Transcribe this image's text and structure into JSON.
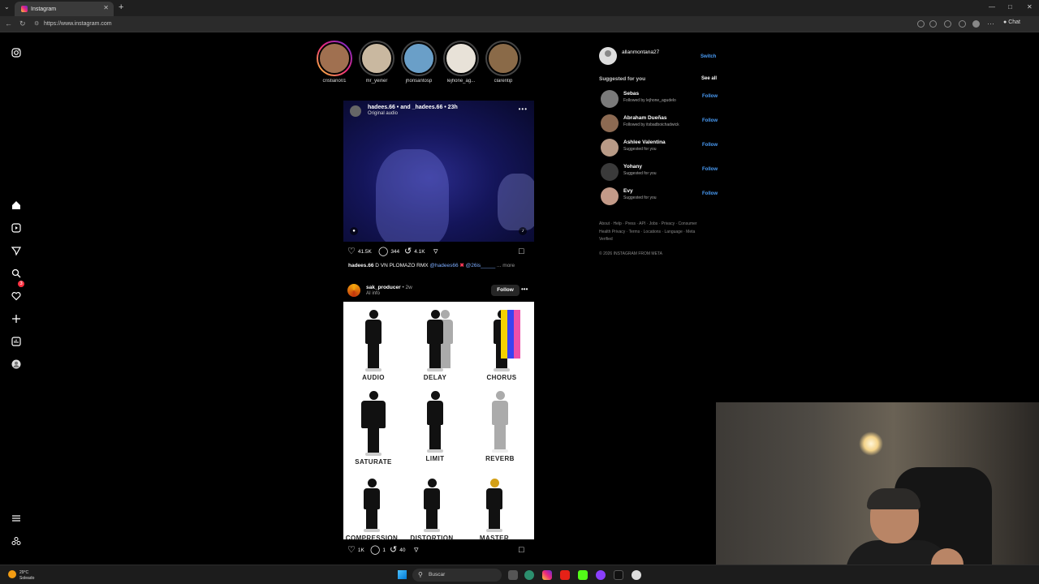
{
  "browser": {
    "tab_title": "Instagram",
    "url": "https://www.instagram.com",
    "chat_label": "Chat"
  },
  "stories": [
    {
      "username": "cristiano01",
      "seen": false,
      "color": "#a07050"
    },
    {
      "username": "mr_yeiner",
      "seen": true,
      "color": "#c9b8a0"
    },
    {
      "username": "jhonsantosp",
      "seen": true,
      "color": "#6a9fc8"
    },
    {
      "username": "lejhone_ag...",
      "seen": true,
      "color": "#e8e2d8"
    },
    {
      "username": "clarentip",
      "seen": true,
      "color": "#8a6a48"
    }
  ],
  "post1": {
    "username": "hadees.66 • and _hadees.66 • 23h",
    "subtitle": "Original audio",
    "likes": "41.5K",
    "comments": "344",
    "reposts": "4.1K",
    "caption_user": "hadees.66",
    "caption_text": " D VN PLOMAZO RMX ",
    "caption_link": "@hadees66",
    "caption_x": "✖",
    "caption_link2": " @26is_____",
    "caption_more": " ... more"
  },
  "post2": {
    "username": "sak_producer",
    "time": " • 2w",
    "subtitle": "AI info",
    "follow_label": "Follow",
    "likes": "1K",
    "comments": "1",
    "reposts": "40",
    "tiles": [
      {
        "label": "AUDIO"
      },
      {
        "label": "DELAY"
      },
      {
        "label": "CHORUS"
      },
      {
        "label": "SATURATE"
      },
      {
        "label": "LIMIT"
      },
      {
        "label": "REVERB"
      },
      {
        "label": "COMPRESSION"
      },
      {
        "label": "DISTORTION"
      },
      {
        "label": "MASTER"
      }
    ]
  },
  "sidebar": {
    "username": "allanmontana27",
    "switch_label": "Switch",
    "suggested_title": "Suggested for you",
    "see_all": "See all",
    "suggestions": [
      {
        "name": "Sebas",
        "sub": "Followed by lejhone_agudelo",
        "follow": "Follow",
        "color": "#7a7a7a"
      },
      {
        "name": "Abraham Dueñas",
        "sub": "Followed by itsbadboichadwick",
        "follow": "Follow",
        "color": "#8c6a52"
      },
      {
        "name": "Ashlee Valentina",
        "sub": "Suggested for you",
        "follow": "Follow",
        "color": "#b89a86"
      },
      {
        "name": "Yohany",
        "sub": "Suggested for you",
        "follow": "Follow",
        "color": "#3a3a3a"
      },
      {
        "name": "Evy",
        "sub": "Suggested for you",
        "follow": "Follow",
        "color": "#c39a88"
      }
    ],
    "footer": "About · Help · Press · API · Jobs · Privacy · Consumer Health Privacy · Terms · Locations · Language · Meta Verified",
    "copyright": "© 2026 INSTAGRAM FROM META"
  },
  "nav": {
    "notification_count": "3"
  },
  "taskbar": {
    "temperature": "29°C",
    "condition": "Soleado",
    "search_label": "Buscar"
  }
}
